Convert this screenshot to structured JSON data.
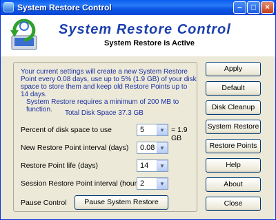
{
  "window": {
    "title": "System Restore Control",
    "controls": [
      "minimize-icon",
      "maximize-icon",
      "close-icon"
    ]
  },
  "header": {
    "app_title": "System Restore Control",
    "status": "System Restore is Active",
    "logo_icon": "system-restore-icon"
  },
  "info": {
    "description": "Your current settings will create a new System Restore Point every 0.08 days, use up to 5% (1.9 GB) of your disk space to store them and keep old Restore Points up to 14 days.",
    "requirement": "System Restore requires a minimum of 200 MB to function.",
    "total_disk_space": "Total Disk Space 37.3 GB"
  },
  "settings": [
    {
      "label": "Percent of disk space to use",
      "value": "5",
      "note": "= 1.9 GB"
    },
    {
      "label": "New Restore Point interval (days)",
      "value": "0.08"
    },
    {
      "label": "Restore Point life (days)",
      "value": "14"
    },
    {
      "label": "Session Restore Point interval (hours)",
      "value": "2"
    }
  ],
  "pause": {
    "label": "Pause Control",
    "button": "Pause System Restore"
  },
  "buttons": {
    "apply": "Apply",
    "default": "Default",
    "disk_cleanup": "Disk Cleanup",
    "system_restore": "System Restore",
    "restore_points": "Restore Points",
    "help": "Help",
    "about": "About",
    "close": "Close"
  }
}
